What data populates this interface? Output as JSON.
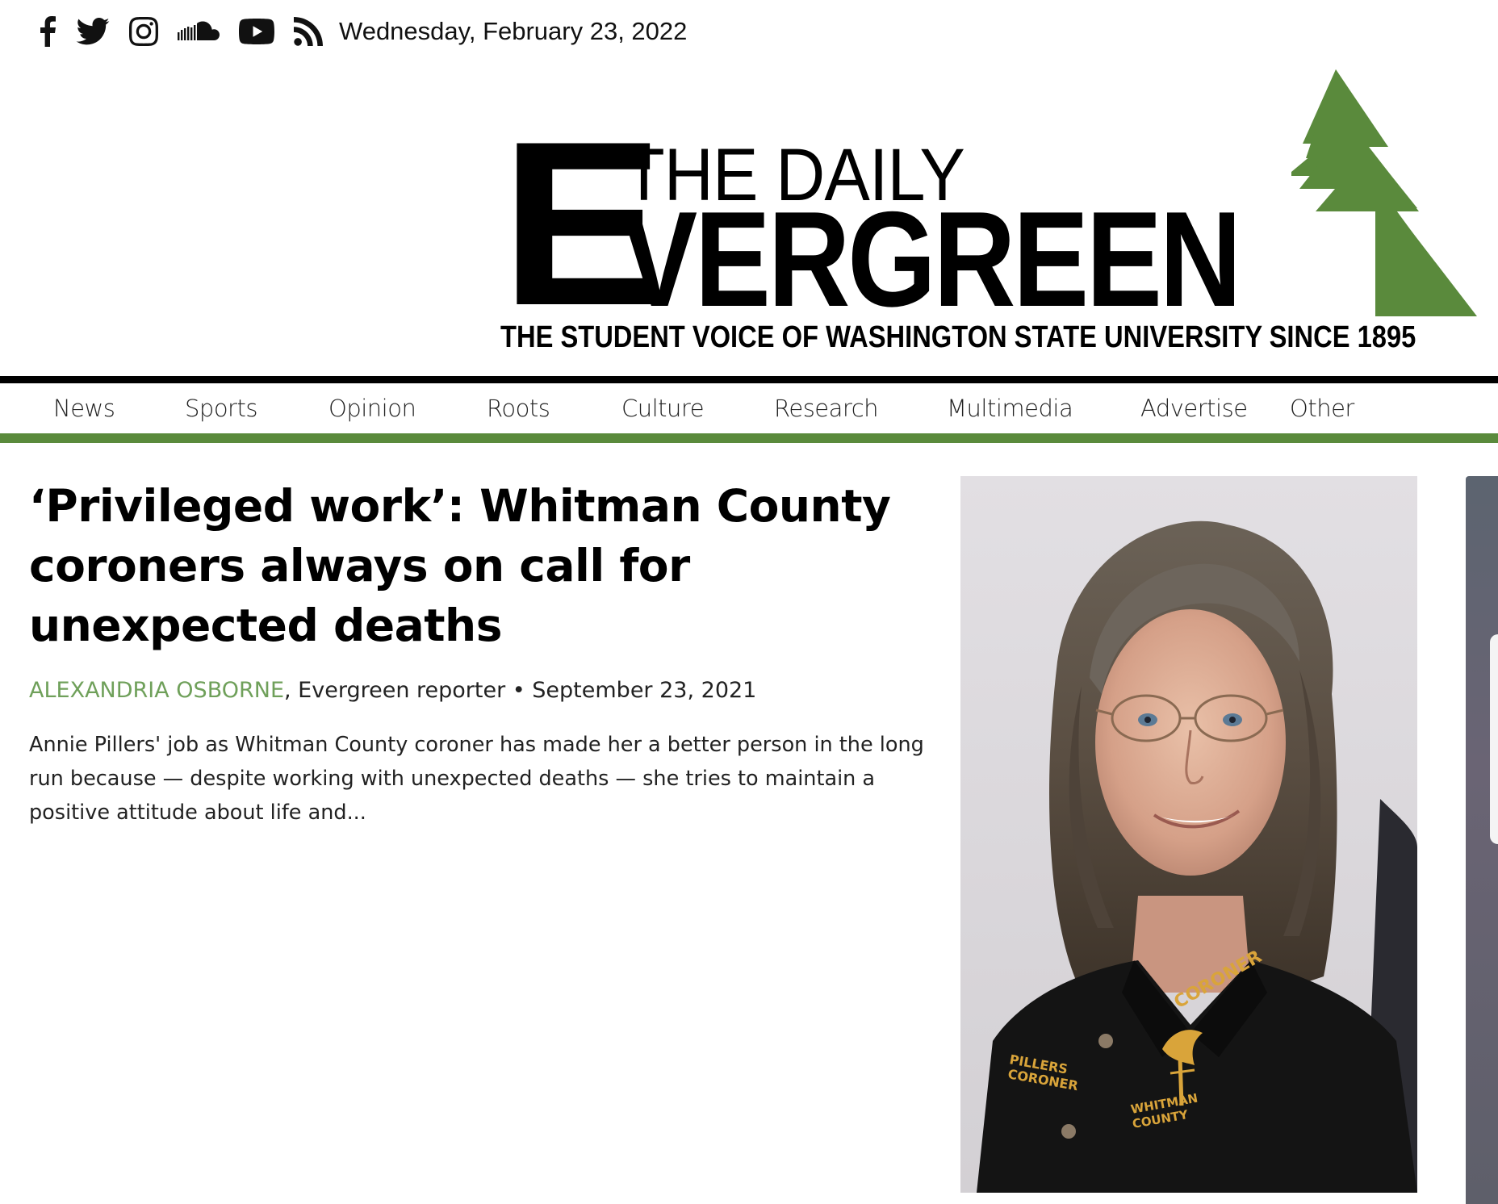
{
  "topbar": {
    "social_icons": [
      "facebook-icon",
      "twitter-icon",
      "instagram-icon",
      "soundcloud-icon",
      "youtube-icon",
      "rss-icon"
    ],
    "date": "Wednesday, February 23, 2022"
  },
  "masthead": {
    "logo_e": "E",
    "logo_the_daily": "THE DAILY",
    "logo_vergreen": "VERGREEN",
    "tagline": "THE STUDENT VOICE OF WASHINGTON STATE UNIVERSITY SINCE 1895",
    "tree_color": "#5a8a3c"
  },
  "nav": {
    "items": [
      {
        "label": "News"
      },
      {
        "label": "Sports"
      },
      {
        "label": "Opinion"
      },
      {
        "label": "Roots"
      },
      {
        "label": "Culture"
      },
      {
        "label": "Research"
      },
      {
        "label": "Multimedia"
      },
      {
        "label": "Advertise"
      },
      {
        "label": "Other"
      }
    ],
    "accent_color": "#5a8a3c"
  },
  "article": {
    "headline": "‘Privileged work’: Whitman County coroners always on call for unexpected deaths",
    "author": "ALEXANDRIA OSBORNE",
    "author_role": ", Evergreen reporter",
    "separator": " • ",
    "date": "September 23, 2021",
    "excerpt": "Annie Pillers' job as Whitman County coroner has made her a better person in the long run because — despite working with unexpected deaths — she tries to maintain a positive attitude about life and...",
    "author_color": "#6fa05a"
  },
  "photo": {
    "shirt_text_left_1": "PILLERS",
    "shirt_text_left_2": "CORONER",
    "shirt_text_right_1": "CORONER",
    "shirt_text_right_2": "WHITMAN",
    "shirt_text_right_3": "COUNTY"
  }
}
